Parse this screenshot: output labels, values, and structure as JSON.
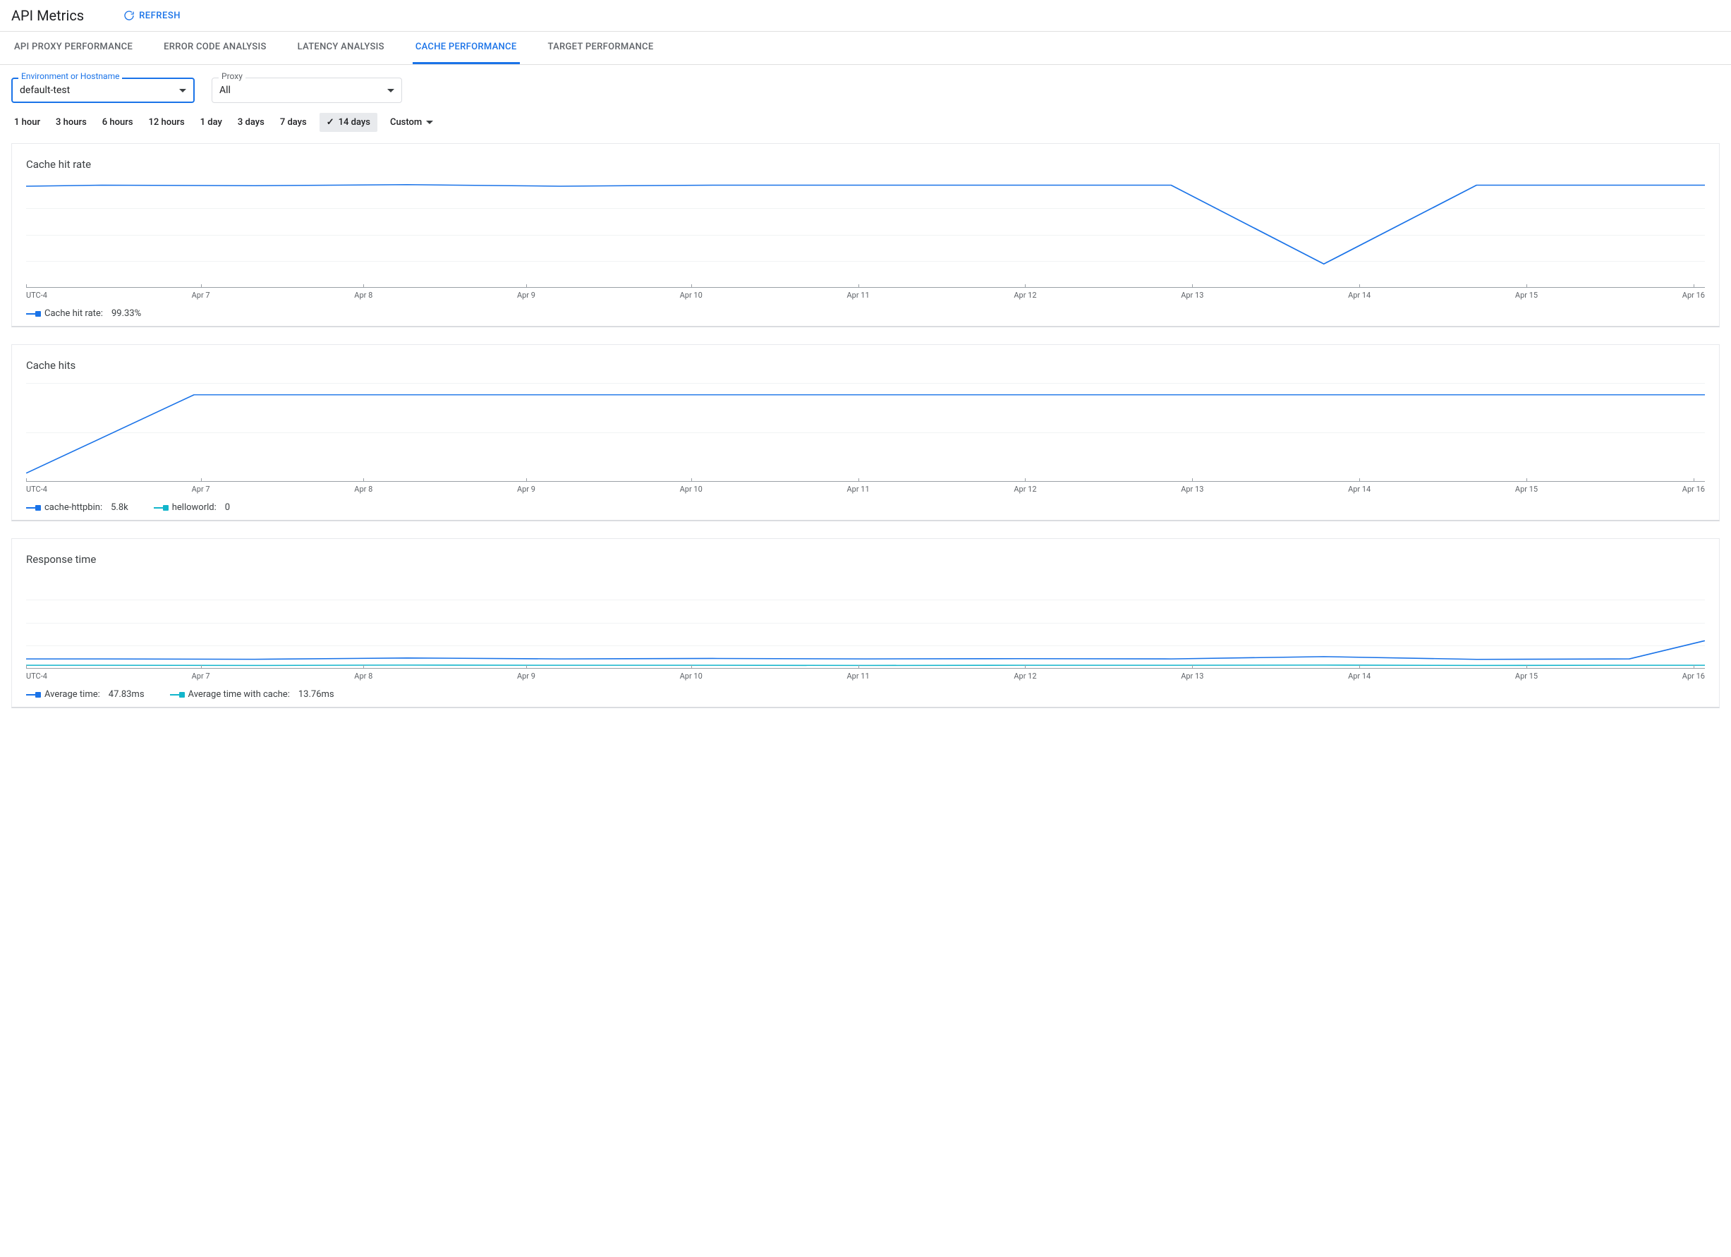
{
  "header": {
    "title": "API Metrics",
    "refresh_label": "REFRESH"
  },
  "tabs": [
    {
      "id": "proxy",
      "label": "API PROXY PERFORMANCE",
      "active": false
    },
    {
      "id": "error",
      "label": "ERROR CODE ANALYSIS",
      "active": false
    },
    {
      "id": "latency",
      "label": "LATENCY ANALYSIS",
      "active": false
    },
    {
      "id": "cache",
      "label": "CACHE PERFORMANCE",
      "active": true
    },
    {
      "id": "target",
      "label": "TARGET PERFORMANCE",
      "active": false
    }
  ],
  "filters": {
    "env_label": "Environment or Hostname",
    "env_value": "default-test",
    "proxy_label": "Proxy",
    "proxy_value": "All"
  },
  "time_ranges": {
    "items": [
      "1 hour",
      "3 hours",
      "6 hours",
      "12 hours",
      "1 day",
      "3 days",
      "7 days",
      "14 days"
    ],
    "selected": "14 days",
    "custom_label": "Custom"
  },
  "x_axis": {
    "tz": "UTC-4",
    "labels": [
      "Apr 7",
      "Apr 8",
      "Apr 9",
      "Apr 10",
      "Apr 11",
      "Apr 12",
      "Apr 13",
      "Apr 14",
      "Apr 15",
      "Apr 16"
    ]
  },
  "colors": {
    "blue": "#1a73e8",
    "teal": "#12b5cb"
  },
  "chart_data": [
    {
      "id": "cache_hit_rate",
      "type": "line",
      "title": "Cache hit rate",
      "xlabel": "",
      "ylabel": "",
      "x": [
        "Apr 6.5",
        "Apr 7",
        "Apr 8",
        "Apr 9",
        "Apr 10",
        "Apr 11",
        "Apr 12",
        "Apr 13",
        "Apr 14",
        "Apr 15",
        "Apr 16",
        "Apr 16.5"
      ],
      "ylim": [
        0,
        100
      ],
      "series": [
        {
          "name": "Cache hit rate",
          "summary": "99.33%",
          "color": "#1a73e8",
          "values": [
            96,
            97,
            96.5,
            97.5,
            96,
            97,
            97,
            97,
            22,
            97,
            97,
            97
          ]
        }
      ]
    },
    {
      "id": "cache_hits",
      "type": "line",
      "title": "Cache hits",
      "xlabel": "",
      "ylabel": "",
      "x": [
        "Apr 6.5",
        "Apr 7",
        "Apr 8",
        "Apr 9",
        "Apr 10",
        "Apr 11",
        "Apr 12",
        "Apr 13",
        "Apr 14",
        "Apr 15",
        "Apr 16",
        "Apr 16.5"
      ],
      "ylim": [
        0,
        700
      ],
      "series": [
        {
          "name": "cache-httpbin",
          "summary": "5.8k",
          "color": "#1a73e8",
          "values": [
            60,
            580,
            580,
            580,
            580,
            580,
            580,
            580,
            580,
            580,
            580,
            580
          ]
        },
        {
          "name": "helloworld",
          "summary": "0",
          "color": "#12b5cb",
          "values": [
            0,
            0,
            0,
            0,
            0,
            0,
            0,
            0,
            0,
            0,
            0,
            0
          ]
        }
      ]
    },
    {
      "id": "response_time",
      "type": "line",
      "title": "Response time",
      "xlabel": "",
      "ylabel": "",
      "x": [
        "Apr 6.5",
        "Apr 7",
        "Apr 8",
        "Apr 9",
        "Apr 10",
        "Apr 11",
        "Apr 12",
        "Apr 13",
        "Apr 14",
        "Apr 15",
        "Apr 16",
        "Apr 16.5"
      ],
      "ylim": [
        0,
        500
      ],
      "series": [
        {
          "name": "Average time",
          "summary": "47.83ms",
          "color": "#1a73e8",
          "values": [
            47,
            47,
            46,
            49,
            47,
            48,
            47,
            48,
            55,
            46,
            47,
            120
          ]
        },
        {
          "name": "Average time with cache",
          "summary": "13.76ms",
          "color": "#12b5cb",
          "values": [
            14,
            14,
            13,
            15,
            14,
            14,
            13,
            14,
            15,
            13,
            14,
            14
          ]
        }
      ]
    }
  ]
}
